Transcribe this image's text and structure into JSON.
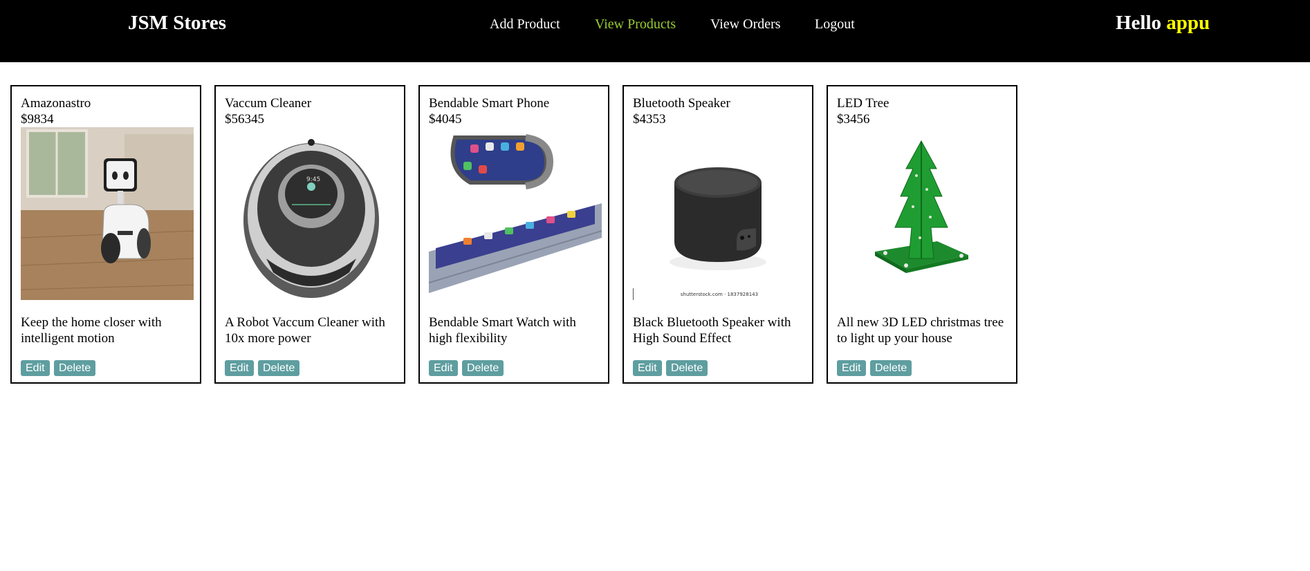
{
  "navbar": {
    "brand": "JSM Stores",
    "links": [
      "Add Product",
      "View Products",
      "View Orders",
      "Logout"
    ],
    "active_link": "View Products",
    "greeting_prefix": "Hello",
    "username": "appu"
  },
  "products": [
    {
      "name": "Amazonastro",
      "price": "$9834",
      "description": "Keep the home closer with intelligent motion",
      "image": "home-robot-image",
      "edit_label": "Edit",
      "delete_label": "Delete"
    },
    {
      "name": "Vaccum Cleaner",
      "price": "$56345",
      "description": "A Robot Vaccum Cleaner with 10x more power",
      "image": "robot-vacuum-image",
      "edit_label": "Edit",
      "delete_label": "Delete"
    },
    {
      "name": "Bendable Smart Phone",
      "price": "$4045",
      "description": "Bendable Smart Watch with high flexibility",
      "image": "bendable-phone-image",
      "edit_label": "Edit",
      "delete_label": "Delete"
    },
    {
      "name": "Bluetooth Speaker",
      "price": "$4353",
      "description": "Black Bluetooth Speaker with High Sound Effect",
      "image": "bluetooth-speaker-image",
      "image_caption": "shutterstock.com · 1837928143",
      "edit_label": "Edit",
      "delete_label": "Delete"
    },
    {
      "name": "LED Tree",
      "price": "$3456",
      "description": "All new 3D LED christmas tree to light up your house",
      "image": "led-tree-image",
      "edit_label": "Edit",
      "delete_label": "Delete"
    }
  ],
  "colors": {
    "navbar_bg": "#000000",
    "active_link": "#9ACD32",
    "username": "#FFFF00",
    "button_bg": "#5F9EA0"
  }
}
